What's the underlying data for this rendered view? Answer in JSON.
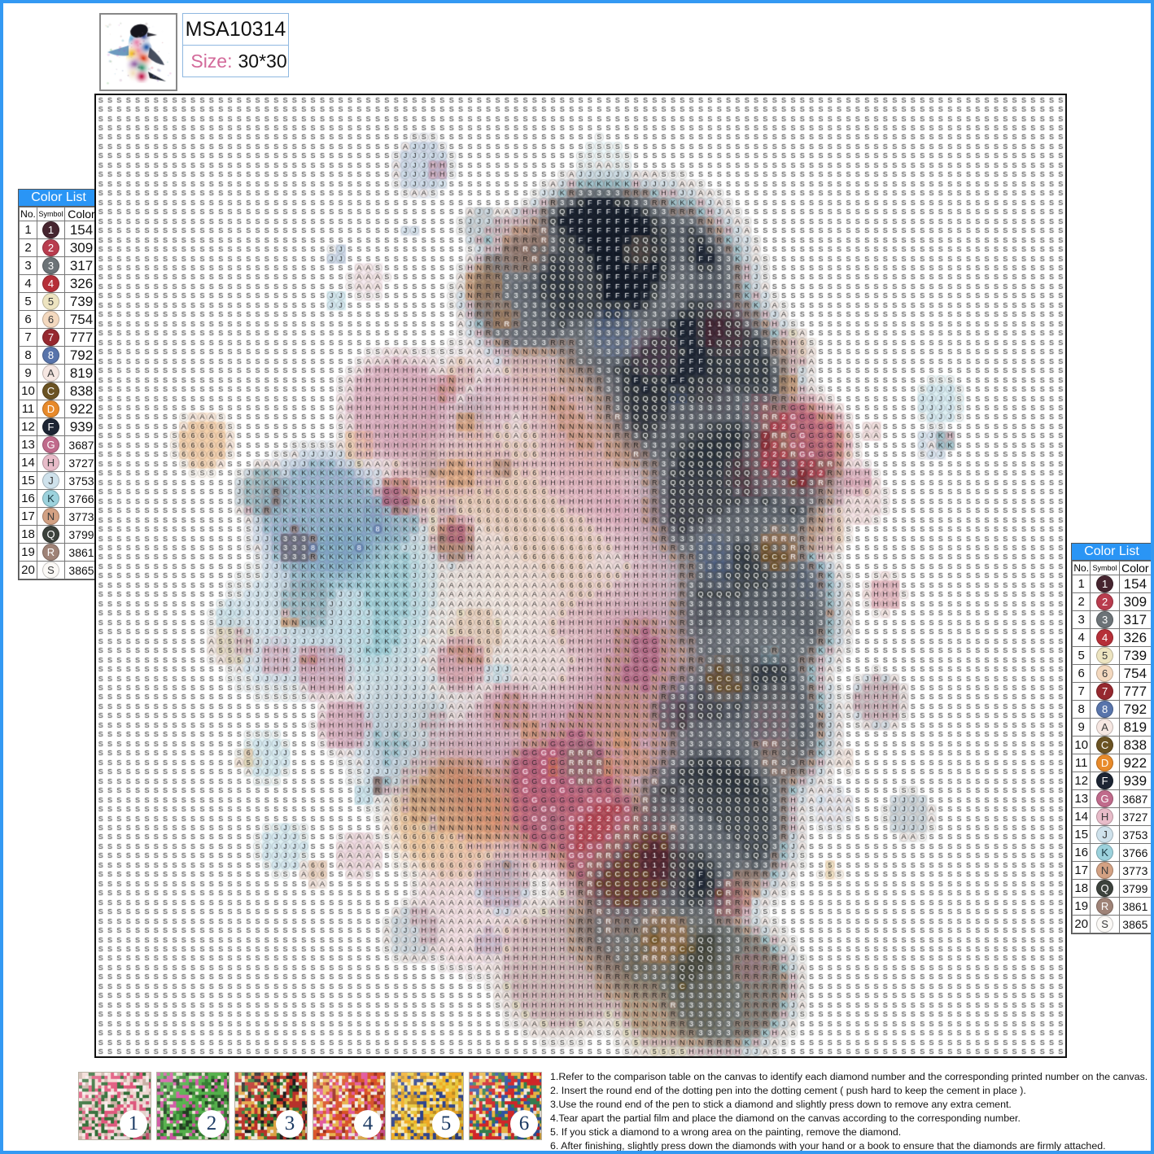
{
  "header": {
    "pattern_code": "MSA10314",
    "size_label": "Size:",
    "size_value": "30*30",
    "thumbnail_name": "penguin-watercolor-thumbnail"
  },
  "color_list": {
    "title": "Color List",
    "columns": [
      "No.",
      "Symbol",
      "Color"
    ],
    "rows": [
      {
        "no": "1",
        "symbol": "1",
        "color": "154",
        "hex": "#46252f",
        "text": "#ffffff"
      },
      {
        "no": "2",
        "symbol": "2",
        "color": "309",
        "hex": "#b93c4e",
        "text": "#ffffff"
      },
      {
        "no": "3",
        "symbol": "3",
        "color": "317",
        "hex": "#6c7377",
        "text": "#ffffff"
      },
      {
        "no": "4",
        "symbol": "4",
        "color": "326",
        "hex": "#b62f38",
        "text": "#ffffff"
      },
      {
        "no": "5",
        "symbol": "5",
        "color": "739",
        "hex": "#ede4c0",
        "text": "#3b3b3b"
      },
      {
        "no": "6",
        "symbol": "6",
        "color": "754",
        "hex": "#f4d9bf",
        "text": "#3b3b3b"
      },
      {
        "no": "7",
        "symbol": "7",
        "color": "777",
        "hex": "#96282f",
        "text": "#ffffff"
      },
      {
        "no": "8",
        "symbol": "8",
        "color": "792",
        "hex": "#5874ab",
        "text": "#ffffff"
      },
      {
        "no": "9",
        "symbol": "A",
        "color": "819",
        "hex": "#f6e7e2",
        "text": "#3b3b3b"
      },
      {
        "no": "10",
        "symbol": "C",
        "color": "838",
        "hex": "#6b5323",
        "text": "#ffffff"
      },
      {
        "no": "11",
        "symbol": "D",
        "color": "922",
        "hex": "#e88a2a",
        "text": "#ffffff"
      },
      {
        "no": "12",
        "symbol": "F",
        "color": "939",
        "hex": "#1c2433",
        "text": "#ffffff"
      },
      {
        "no": "13",
        "symbol": "G",
        "color": "3687",
        "hex": "#c06a8b",
        "text": "#ffffff"
      },
      {
        "no": "14",
        "symbol": "H",
        "color": "3727",
        "hex": "#e8bcc9",
        "text": "#3b3b3b"
      },
      {
        "no": "15",
        "symbol": "J",
        "color": "3753",
        "hex": "#cfe2ec",
        "text": "#3b3b3b"
      },
      {
        "no": "16",
        "symbol": "K",
        "color": "3766",
        "hex": "#9cd2dd",
        "text": "#1b3b44"
      },
      {
        "no": "17",
        "symbol": "N",
        "color": "3773",
        "hex": "#d3a183",
        "text": "#3b3b3b"
      },
      {
        "no": "18",
        "symbol": "Q",
        "color": "3799",
        "hex": "#3c423c",
        "text": "#ffffff"
      },
      {
        "no": "19",
        "symbol": "R",
        "color": "3861",
        "hex": "#9f8377",
        "text": "#ffffff"
      },
      {
        "no": "20",
        "symbol": "S",
        "color": "3865",
        "hex": "#fbf9f6",
        "text": "#3b3b3b"
      }
    ]
  },
  "pattern": {
    "background_symbol": "S",
    "grid_columns": 105,
    "grid_rows": 103,
    "subject": "watercolor penguin"
  },
  "steps": [
    {
      "number": "1",
      "name": "step-thumbnail-1"
    },
    {
      "number": "2",
      "name": "step-thumbnail-2"
    },
    {
      "number": "3",
      "name": "step-thumbnail-3"
    },
    {
      "number": "4",
      "name": "step-thumbnail-4"
    },
    {
      "number": "5",
      "name": "step-thumbnail-5"
    },
    {
      "number": "6",
      "name": "step-thumbnail-6"
    }
  ],
  "instructions": [
    "1.Refer to the comparison table on the canvas to identify each diamond number and the corresponding printed number on the canvas.",
    "2. Insert the round end of the dotting pen into the dotting cement ( push hard to keep the cement in place ).",
    "3.Use the round end of the pen to stick a diamond and slightly press down to remove any extra cement.",
    "4.Tear apart the partial film and place the diamond on the canvas according to the corresponding number.",
    "5. If you stick a diamond to a wrong area on the painting,   remove the diamond.",
    "6. After finishing, slightly press down the diamonds with your hand or a book to ensure that the diamonds are firmly attached."
  ],
  "colors": {
    "border_blue": "#3399f3",
    "title_blue": "#2a95f5",
    "size_pink": "#d36a9a"
  }
}
